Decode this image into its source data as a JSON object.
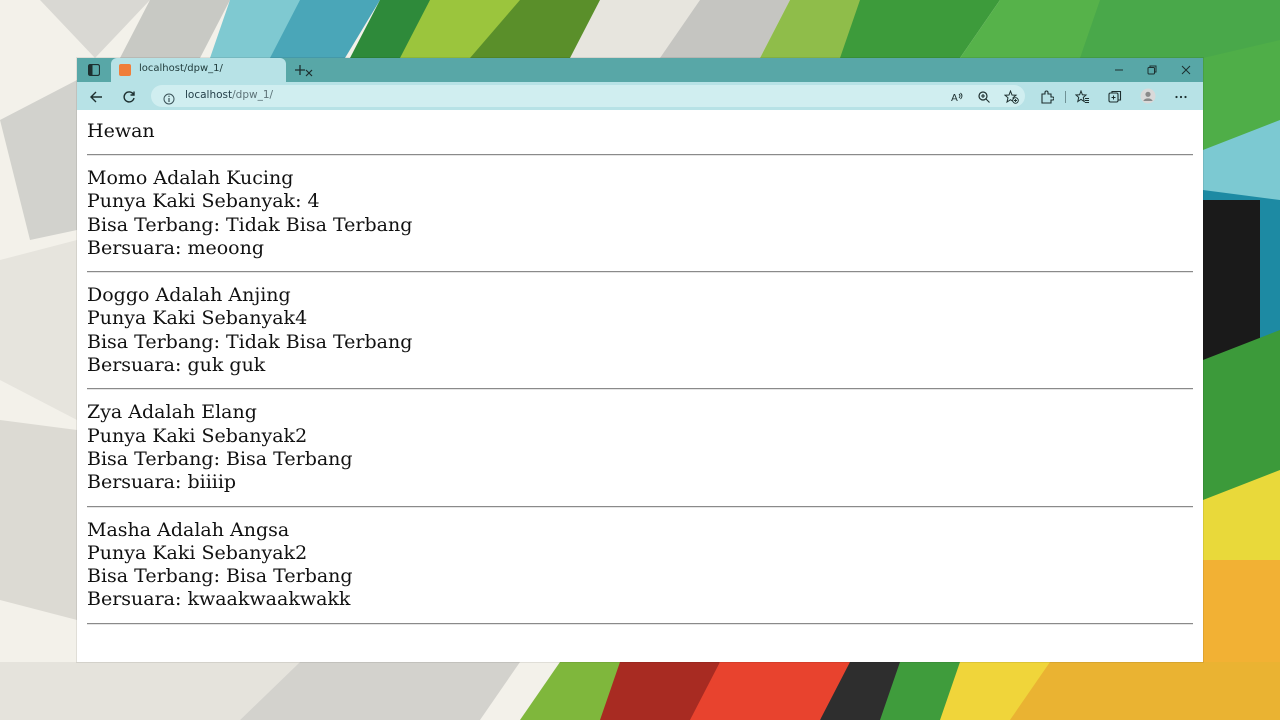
{
  "browser": {
    "tab_title": "localhost/dpw_1/",
    "url_host": "localhost",
    "url_path": "/dpw_1/"
  },
  "page": {
    "title": "Hewan",
    "animals": [
      {
        "name_line": "Momo Adalah Kucing",
        "legs_line": "Punya Kaki Sebanyak: 4",
        "fly_line": "Bisa Terbang: Tidak Bisa Terbang",
        "sound_line": "Bersuara: meoong"
      },
      {
        "name_line": "Doggo Adalah Anjing",
        "legs_line": "Punya Kaki Sebanyak4",
        "fly_line": "Bisa Terbang: Tidak Bisa Terbang",
        "sound_line": "Bersuara: guk guk"
      },
      {
        "name_line": "Zya Adalah Elang",
        "legs_line": "Punya Kaki Sebanyak2",
        "fly_line": "Bisa Terbang: Bisa Terbang",
        "sound_line": "Bersuara: biiiip"
      },
      {
        "name_line": "Masha Adalah Angsa",
        "legs_line": "Punya Kaki Sebanyak2",
        "fly_line": "Bisa Terbang: Bisa Terbang",
        "sound_line": "Bersuara: kwaakwaakwakk"
      }
    ]
  },
  "icons": {
    "tab_actions": "tab-actions-icon",
    "favicon": "xampp-favicon-icon",
    "close_tab": "close-icon",
    "new_tab": "plus-icon",
    "minimize": "minimize-icon",
    "restore": "restore-icon",
    "close_window": "close-icon",
    "back": "back-arrow-icon",
    "refresh": "refresh-icon",
    "site_info": "info-icon",
    "read_aloud": "read-aloud-icon",
    "zoom": "zoom-icon",
    "favorite": "add-favorite-icon",
    "extensions": "extensions-icon",
    "favorites": "favorites-icon",
    "collections": "collections-icon",
    "profile": "profile-icon",
    "more": "more-icon"
  },
  "colors": {
    "titlebar": "#58a7a7",
    "toolbar": "#b7e2e6",
    "address_bar": "#d0eef0"
  }
}
